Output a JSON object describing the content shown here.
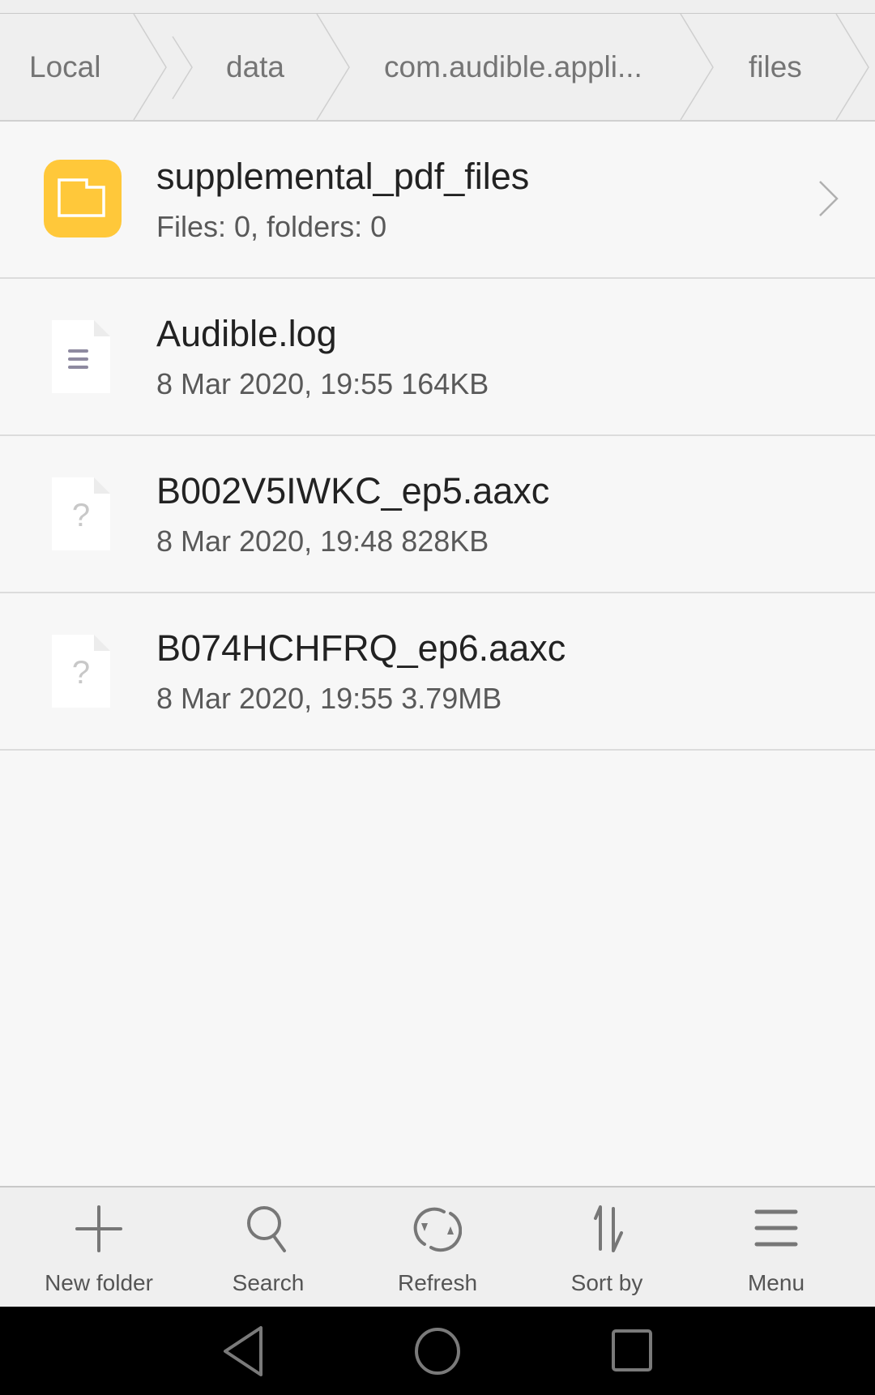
{
  "breadcrumb": {
    "items": [
      {
        "label": "Local"
      },
      {
        "label": "data"
      },
      {
        "label": "com.audible.appli..."
      },
      {
        "label": "files"
      }
    ]
  },
  "files": [
    {
      "name": "supplemental_pdf_files",
      "meta": "Files: 0, folders: 0",
      "type": "folder",
      "icon": "folder-icon"
    },
    {
      "name": "Audible.log",
      "meta": "8 Mar 2020, 19:55 164KB",
      "type": "text",
      "icon": "text-file-icon"
    },
    {
      "name": "B002V5IWKC_ep5.aaxc",
      "meta": "8 Mar 2020, 19:48 828KB",
      "type": "unknown",
      "icon": "unknown-file-icon"
    },
    {
      "name": "B074HCHFRQ_ep6.aaxc",
      "meta": "8 Mar 2020, 19:55 3.79MB",
      "type": "unknown",
      "icon": "unknown-file-icon"
    }
  ],
  "toolbar": {
    "new_folder": "New folder",
    "search": "Search",
    "refresh": "Refresh",
    "sort_by": "Sort by",
    "menu": "Menu"
  },
  "colors": {
    "folder_accent": "#FFC83A",
    "icon_gray": "#7a7a7a",
    "background": "#f7f7f7"
  }
}
